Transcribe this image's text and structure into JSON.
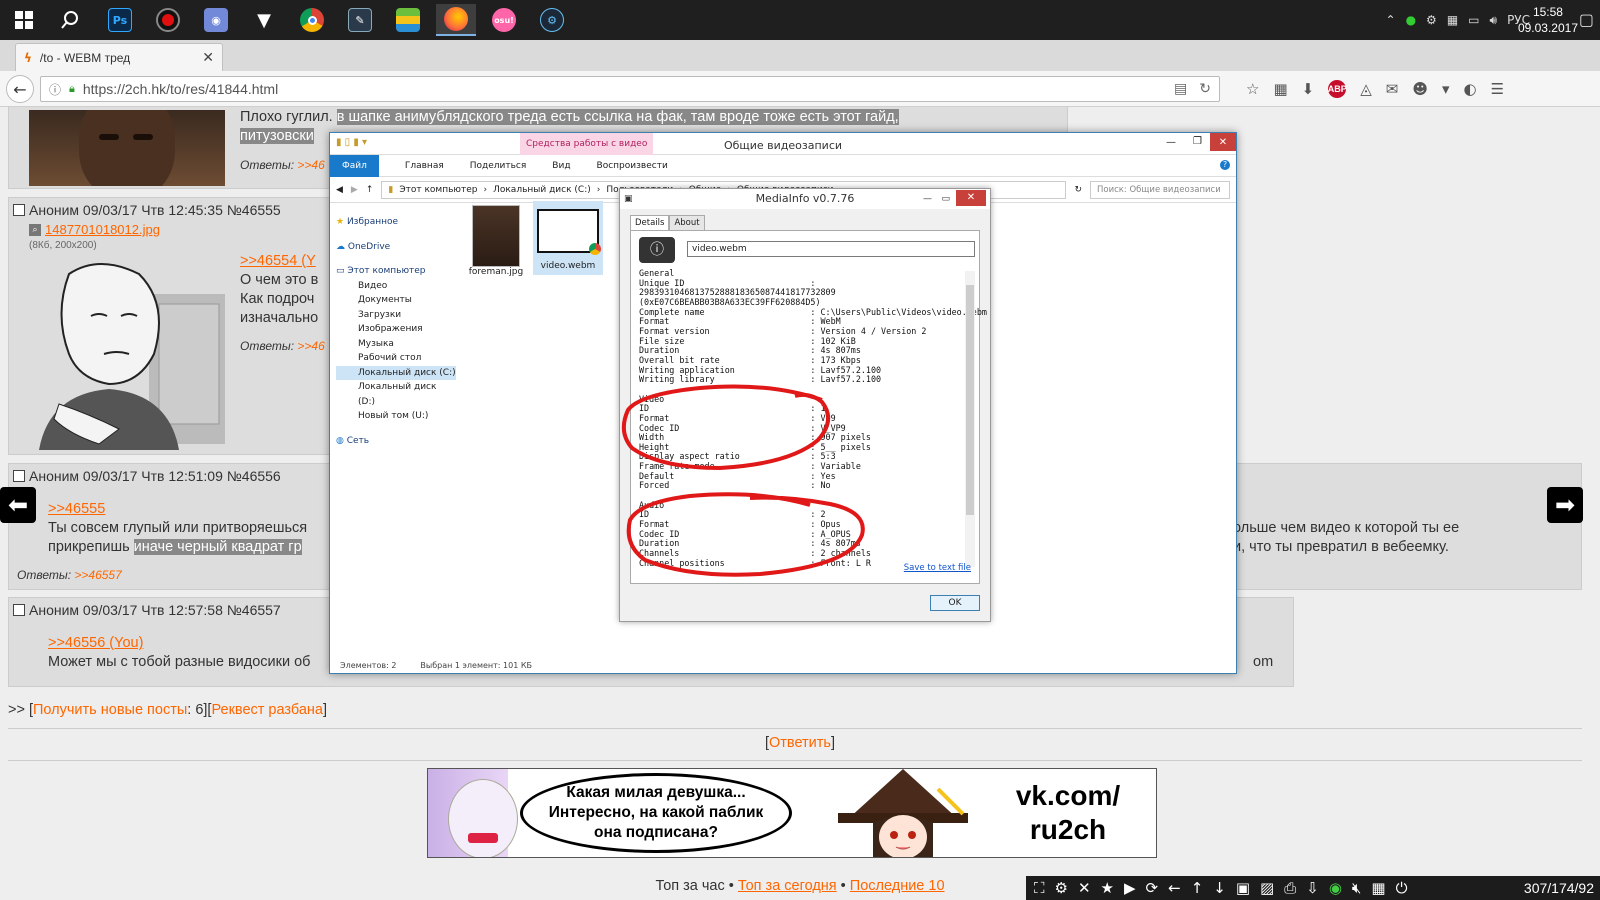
{
  "taskbar": {
    "lang": "РУС",
    "time": "15:58",
    "date": "09.03.2017",
    "apps": [
      "start",
      "search",
      "photoshop",
      "recorder",
      "discord",
      "fox-app",
      "chrome",
      "stylus-app",
      "bluestacks",
      "firefox",
      "osu",
      "steam"
    ],
    "osu_label": "osu!",
    "ps_label": "Ps"
  },
  "browser": {
    "tab_title": "/to - WEBM тред",
    "url": "https://2ch.hk/to/res/41844.html"
  },
  "posts": {
    "p0": {
      "text_before": "Плохо гуглил.",
      "text_hl_line1": "в шапке анимублядского треда есть ссылка на фак, там вроде тоже есть этот гайд,",
      "text_hl_line2": "питузовски",
      "answers_label": "Ответы:",
      "answers_link": ">>46"
    },
    "p1": {
      "header": "Аноним 09/03/17 Чтв 12:45:35 №46555",
      "file_name": "1487701018012.jpg",
      "file_meta": "(8Кб, 200x200)",
      "reply_link": ">>46554 (Y",
      "line1": "О чем это в",
      "line2": "Как подроч",
      "line3": "изначально",
      "answers_label": "Ответы:",
      "answers_link": ">>46"
    },
    "p2": {
      "header": "Аноним 09/03/17 Чтв 12:51:09 №46556",
      "reply_link": ">>46555",
      "line1": "Ты совсем глупый или притворяешься",
      "line1_right": "ольше чем видео к которой ты ее",
      "line2_plain": "прикрепишь",
      "line2_hl": "иначе черный квадрат гр",
      "line2_right": "и, что ты превратил в вебеемку.",
      "answers_label": "Ответы:",
      "answers_link": ">>46557"
    },
    "p3": {
      "header": "Аноним 09/03/17 Чтв 12:57:58 №46557",
      "reply_link": ">>46556 (You)",
      "line1": "Может мы с тобой разные видосики об",
      "line1_right": "om"
    }
  },
  "explorer": {
    "context_tab": "Средства работы с видео",
    "title": "Общие видеозаписи",
    "ribbon": [
      "Файл",
      "Главная",
      "Поделиться",
      "Вид",
      "Воспроизвести"
    ],
    "path": [
      "Этот компьютер",
      "Локальный диск (C:)",
      "Пользователи",
      "Общие",
      "Общие видеозаписи"
    ],
    "search_placeholder": "Поиск: Общие видеозаписи",
    "nav": {
      "favorites": "Избранное",
      "onedrive": "OneDrive",
      "this_pc": "Этот компьютер",
      "items": [
        "Видео",
        "Документы",
        "Загрузки",
        "Изображения",
        "Музыка",
        "Рабочий стол",
        "Локальный диск (C:)",
        "Локальный диск (D:)",
        "Новый том (U:)"
      ],
      "network": "Сеть"
    },
    "files": [
      "foreman.jpg",
      "video.webm"
    ],
    "status_count": "Элементов: 2",
    "status_sel": "Выбран 1 элемент: 101 КБ"
  },
  "mediainfo": {
    "title": "MediaInfo v0.7.76",
    "tabs": [
      "Details",
      "About"
    ],
    "file_field": "video.webm",
    "report": "General\nUnique ID                         :\n298393104681375288818365087441817732809\n(0xE07C6BEABB03B8A633EC39FF620884D5)\nComplete name                     : C:\\Users\\Public\\Videos\\video.webm\nFormat                            : WebM\nFormat version                    : Version 4 / Version 2\nFile size                         : 102 KiB\nDuration                          : 4s 807ms\nOverall bit rate                  : 173 Kbps\nWriting application               : Lavf57.2.100\nWriting library                   : Lavf57.2.100\n\nVideo\nID                                : 1\nFormat                            : VP9\nCodec ID                          : V_VP9\nWidth                             : 907 pixels\nHeight                            : 5__ pixels\nDisplay aspect ratio              : 5:3\nFrame rate mode                   : Variable\nDefault                           : Yes\nForced                            : No\n\nAudio\nID                                : 2\nFormat                            : Opus\nCodec ID                          : A_OPUS\nDuration                          : 4s 807ms\nChannels                          : 2 channels\nChannel positions                 : Front: L R",
    "save_link": "Save to text file",
    "ok": "OK"
  },
  "page_footer": {
    "prefix": ">> [",
    "get_new": "Получить новые посты",
    "count_sep": ": 6][",
    "request": "Реквест разбана",
    "suffix": "]",
    "reply_l": "[",
    "reply": "Ответить",
    "reply_r": "]"
  },
  "banner": {
    "bubble_line1": "Какая милая девушка...",
    "bubble_line2": "Интересно, на какой паблик",
    "bubble_line3": "она подписана?",
    "vk_line1": "vk.com/",
    "vk_line2": "ru2ch"
  },
  "bottom_nav": {
    "top_hour": "Топ за час",
    "sep": " • ",
    "top_today": "Топ за сегодня",
    "last10": "Последние 10"
  },
  "dollchan": {
    "counter": "307/174/92"
  }
}
